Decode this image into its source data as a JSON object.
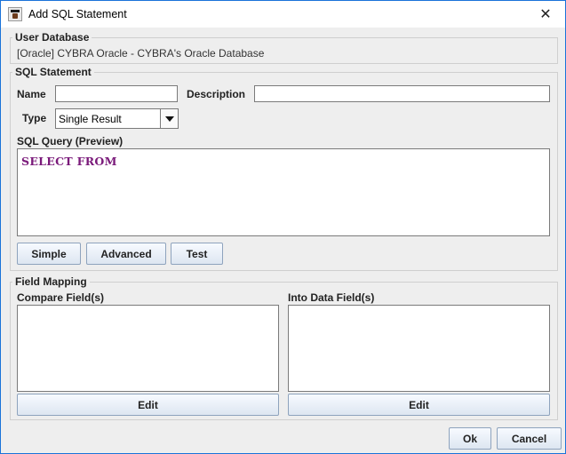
{
  "window": {
    "title": "Add SQL Statement",
    "close_glyph": "✕"
  },
  "user_database": {
    "legend": "User Database",
    "value": "[Oracle] CYBRA Oracle - CYBRA's Oracle Database"
  },
  "sql_statement": {
    "legend": "SQL Statement",
    "name_label": "Name",
    "name_value": "",
    "description_label": "Description",
    "description_value": "",
    "type_label": "Type",
    "type_value": "Single Result",
    "preview_label": "SQL Query (Preview)",
    "query_text": "SELECT FROM",
    "buttons": {
      "simple": "Simple",
      "advanced": "Advanced",
      "test": "Test"
    }
  },
  "field_mapping": {
    "legend": "Field Mapping",
    "compare_label": "Compare Field(s)",
    "into_label": "Into Data Field(s)",
    "compare_edit": "Edit",
    "into_edit": "Edit"
  },
  "footer": {
    "ok": "Ok",
    "cancel": "Cancel"
  },
  "colors": {
    "sql_keyword": "#7a1a7a",
    "window_border": "#1a73d9"
  },
  "icons": {
    "app": "app-icon",
    "close": "close-icon",
    "dropdown": "chevron-down-icon"
  }
}
